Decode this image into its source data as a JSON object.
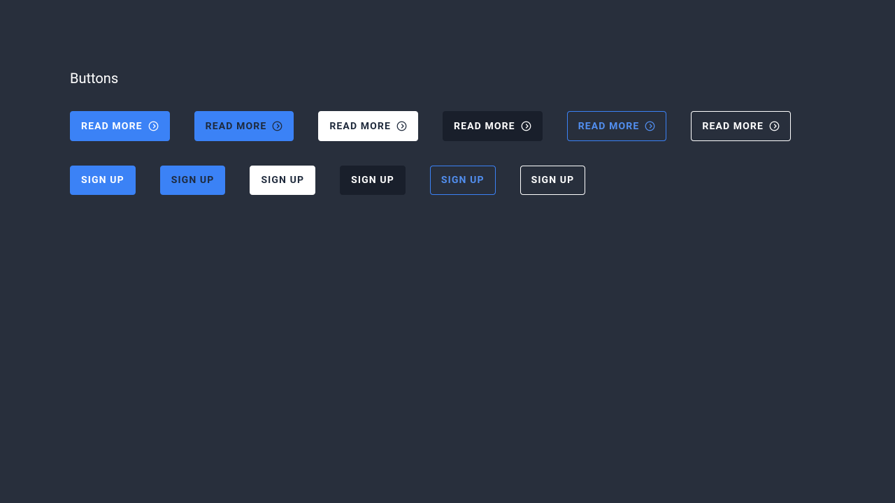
{
  "section_title": "Buttons",
  "colors": {
    "background": "#282f3c",
    "primary_blue": "#3b82f6",
    "dark_button": "#191f2b",
    "white": "#ffffff",
    "dark_text": "#1e293b"
  },
  "row1": {
    "label": "Read More",
    "icon": "arrow-right-circle-icon",
    "buttons": [
      {
        "variant": "primary",
        "label": "Read More"
      },
      {
        "variant": "primary-dark",
        "label": "Read More"
      },
      {
        "variant": "white",
        "label": "Read More"
      },
      {
        "variant": "dark",
        "label": "Read More"
      },
      {
        "variant": "outline-blue",
        "label": "Read More"
      },
      {
        "variant": "outline-white",
        "label": "Read More"
      }
    ]
  },
  "row2": {
    "label": "Sign Up",
    "buttons": [
      {
        "variant": "primary",
        "label": "Sign Up"
      },
      {
        "variant": "primary-dark",
        "label": "Sign Up"
      },
      {
        "variant": "white",
        "label": "Sign Up"
      },
      {
        "variant": "dark",
        "label": "Sign Up"
      },
      {
        "variant": "outline-blue",
        "label": "Sign Up"
      },
      {
        "variant": "outline-white",
        "label": "Sign Up"
      }
    ]
  }
}
